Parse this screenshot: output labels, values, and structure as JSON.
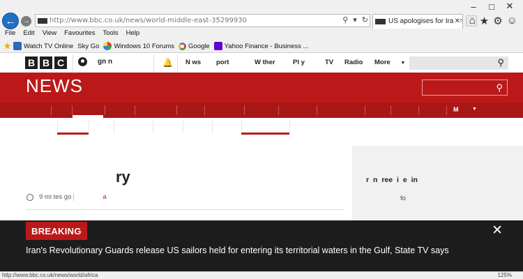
{
  "browser": {
    "window_controls": {
      "minimize": "–",
      "maximize": "□",
      "close": "✕"
    },
    "url": "http://www.bbc.co.uk/news/world-middle-east-35299930",
    "tab_title": "US apologises for Iran na...",
    "menu": [
      "File",
      "Edit",
      "View",
      "Favourites",
      "Tools",
      "Help"
    ],
    "favourites": [
      "Watch TV Online",
      "Sky Go",
      "Windows 10 Forums",
      "Google",
      "Yahoo Finance - Business ..."
    ],
    "status_url": "http://www.bbc.co.uk/news/world/africa",
    "zoom": "125%"
  },
  "bbc": {
    "logo": [
      "B",
      "B",
      "C"
    ],
    "signin": "gn n",
    "nav": [
      "N ws",
      "port",
      "W  ther",
      "Pl y",
      "TV",
      "Radio",
      "More"
    ],
    "section_title": "NEWS",
    "subnav_more": "M"
  },
  "article": {
    "headline": "ry",
    "time": "9 mi    tes  go",
    "section": "a"
  },
  "sidebar": {
    "title": "r n ree            i        e  in",
    "subtitle": "fo"
  },
  "breaking": {
    "label": "BREAKING",
    "text": "Iran's Revolutionary Guards release US sailors held for entering its territorial waters in the Gulf, State TV says"
  },
  "colors": {
    "bbc_red": "#bb1919",
    "ie_blue": "#1f6fc5"
  }
}
